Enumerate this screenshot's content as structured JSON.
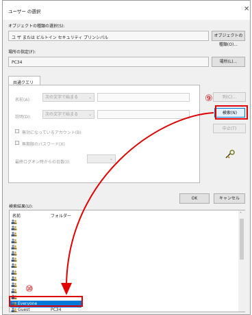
{
  "dialog": {
    "title": "ユーザー の選択",
    "object_type_label": "オブジェクトの種類の選択(S):",
    "object_type_value": "ユ ザ  または ビルトイン セキュリティ プリンシパル",
    "object_types_button": "オブジェクトの種類(O)...",
    "location_label": "場所の指定(F):",
    "location_value": "PC34",
    "locations_button": "場所(L)...",
    "tab_common_queries": "共通クエリ",
    "name_label": "名前(A):",
    "name_combo": "次の文字で始まる",
    "desc_label": "説明(D):",
    "desc_combo": "次の文字で始まる",
    "disabled_accounts": "無効になっているアカウント(B)",
    "no_expire_password": "無期限のパスワード(X)",
    "days_since_logon": "最終ログオン時からの日数(I):",
    "columns_button": "列(C)...",
    "search_button": "検索(N)",
    "stop_button": "中止(T)",
    "ok_button": "OK",
    "cancel_button": "キャンセル",
    "results_label": "検索結果(U):",
    "results_columns": [
      "名前",
      "フォルダー"
    ],
    "results_rows": [
      {
        "name": "",
        "folder": ""
      },
      {
        "name": "",
        "folder": ""
      },
      {
        "name": "",
        "folder": ""
      },
      {
        "name": "",
        "folder": ""
      },
      {
        "name": "",
        "folder": ""
      },
      {
        "name": "",
        "folder": ""
      },
      {
        "name": "",
        "folder": ""
      },
      {
        "name": "",
        "folder": ""
      },
      {
        "name": "",
        "folder": ""
      },
      {
        "name": "",
        "folder": ""
      },
      {
        "name": "",
        "folder": ""
      },
      {
        "name": "",
        "folder": ""
      },
      {
        "name": "",
        "folder": ""
      },
      {
        "name": "Everyone",
        "folder": "",
        "selected": true
      },
      {
        "name": "Guest",
        "folder": "PC34"
      }
    ]
  },
  "annotations": {
    "step9": "⑨",
    "step10": "⑩",
    "color": "#e00000"
  }
}
